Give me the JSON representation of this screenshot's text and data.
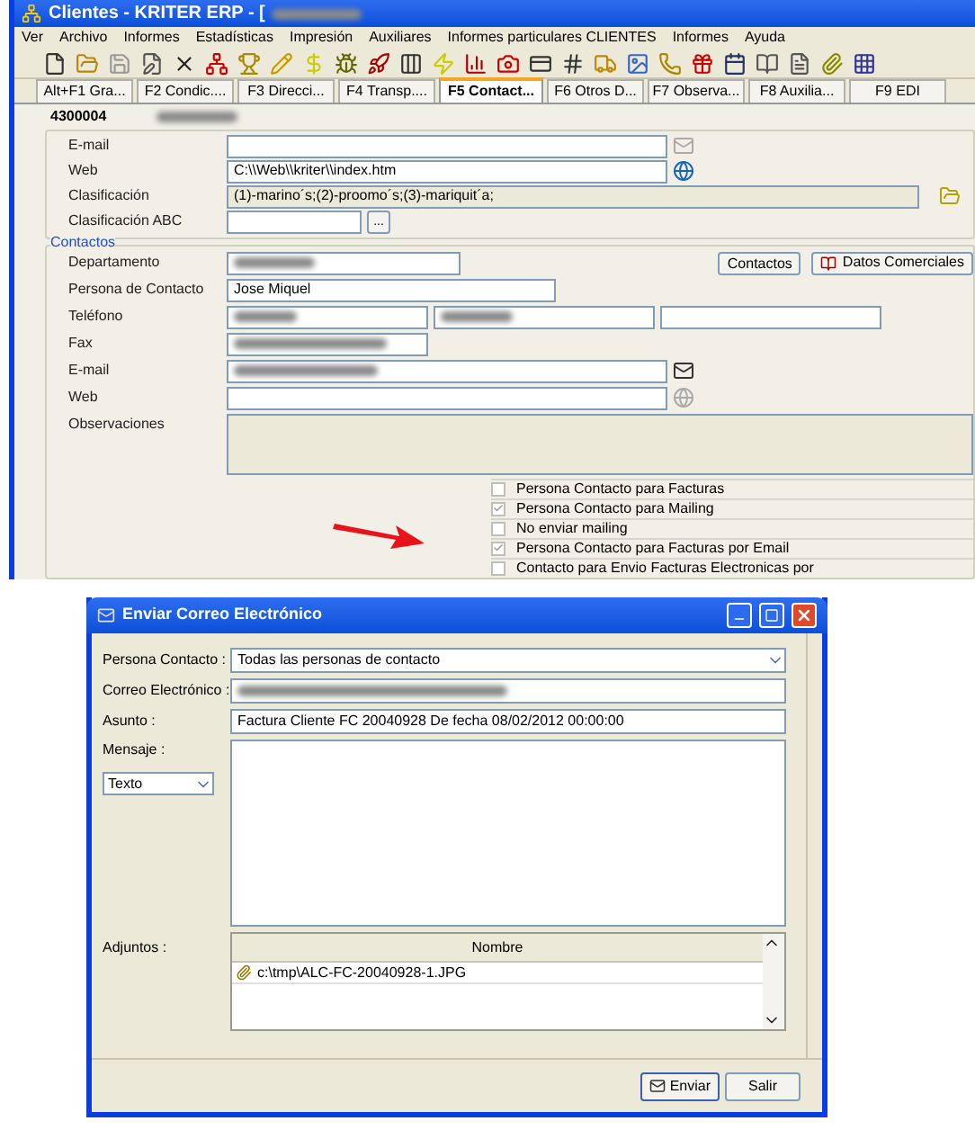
{
  "main_window": {
    "title": "Clientes - KRITER ERP - [",
    "menu": [
      "Ver",
      "Archivo",
      "Informes",
      "Estadísticas",
      "Impresión",
      "Auxiliares",
      "Informes particulares CLIENTES",
      "Informes",
      "Ayuda"
    ],
    "tabs": [
      {
        "label": "Alt+F1 Gra...",
        "selected": false
      },
      {
        "label": "F2 Condic....",
        "selected": false
      },
      {
        "label": "F3 Direcci...",
        "selected": false
      },
      {
        "label": "F4 Transp....",
        "selected": false
      },
      {
        "label": "F5 Contact...",
        "selected": true
      },
      {
        "label": "F6 Otros D...",
        "selected": false
      },
      {
        "label": "F7 Observa...",
        "selected": false
      },
      {
        "label": "F8 Auxilia...",
        "selected": false
      },
      {
        "label": "F9 EDI",
        "selected": false
      }
    ],
    "code": "4300004",
    "general": {
      "email_label": "E-mail",
      "web_label": "Web",
      "web_value": "C:\\\\Web\\\\kriter\\\\index.htm",
      "clasificacion_label": "Clasificación",
      "clasificacion_value": "(1)-marino´s;(2)-proomo´s;(3)-mariquit´a;",
      "abc_label": "Clasificación ABC",
      "abc_button": "..."
    },
    "contactos": {
      "legend": "Contactos",
      "departamento_label": "Departamento",
      "contactos_button": "Contactos",
      "datos_button": "Datos Comerciales",
      "persona_label": "Persona de Contacto",
      "persona_value": "Jose Miquel",
      "telefono_label": "Teléfono",
      "fax_label": "Fax",
      "email_label": "E-mail",
      "web_label": "Web",
      "observaciones_label": "Observaciones",
      "options": [
        {
          "label": "Persona Contacto para Facturas",
          "checked": false
        },
        {
          "label": "Persona Contacto para Mailing",
          "checked": true
        },
        {
          "label": "No enviar mailing",
          "checked": false
        },
        {
          "label": "Persona Contacto para Facturas por Email",
          "checked": true
        },
        {
          "label": "Contacto para Envio Facturas Electronicas por",
          "checked": false
        }
      ]
    }
  },
  "dialog": {
    "title": "Enviar Correo Electrónico",
    "persona_label": "Persona Contacto :",
    "persona_value": "Todas las personas de contacto",
    "correo_label": "Correo Electrónico :",
    "asunto_label": "Asunto :",
    "asunto_value": "Factura Cliente FC 20040928 De fecha 08/02/2012 00:00:00",
    "mensaje_label": "Mensaje :",
    "formato_value": "Texto",
    "adjuntos_label": "Adjuntos :",
    "adjuntos_column": "Nombre",
    "adjuntos": [
      "c:\\tmp\\ALC-FC-20040928-1.JPG"
    ],
    "buttons": [
      "Enviar",
      "Salir"
    ]
  }
}
